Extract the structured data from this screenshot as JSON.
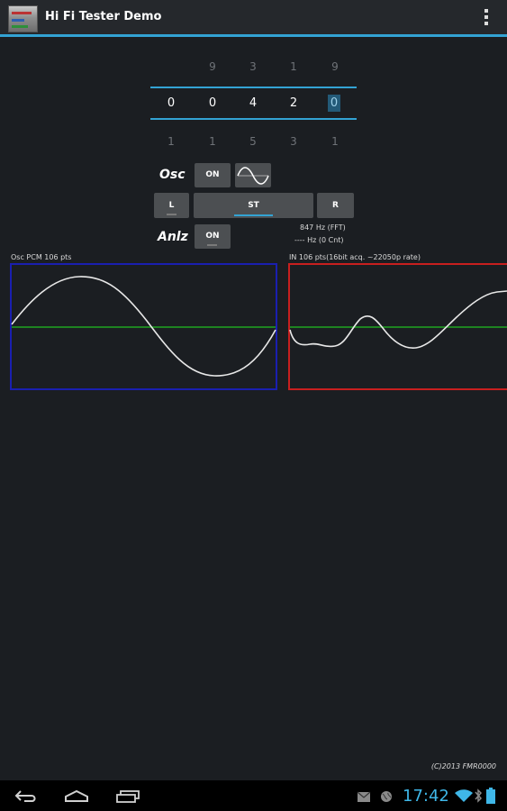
{
  "app": {
    "title": "Hi Fi Tester Demo",
    "icon": "app-icon",
    "overflow_icon": "overflow-menu-icon"
  },
  "picker": {
    "top": [
      "9",
      "3",
      "1",
      "9"
    ],
    "middle": [
      "0",
      "0",
      "4",
      "2",
      "0"
    ],
    "bottom": [
      "1",
      "1",
      "5",
      "3",
      "1"
    ]
  },
  "osc": {
    "label": "Osc",
    "on_label": "ON",
    "waveform_icon": "sine-wave-icon"
  },
  "channels": {
    "left": "L",
    "stereo": "ST",
    "right": "R"
  },
  "anlz": {
    "label": "Anlz",
    "on_label": "ON"
  },
  "readouts": {
    "fft": "847 Hz (FFT)",
    "cnt": "---- Hz (0 Cnt)"
  },
  "scopes": {
    "left_title": "Osc PCM 106 pts",
    "right_title": "IN 106 pts(16bit acq. ~22050p rate)"
  },
  "footer": {
    "copyright": "(C)2013 FMR0000"
  },
  "status": {
    "time": "17:42"
  },
  "colors": {
    "accent": "#33a3d4",
    "left_scope_border": "#1a1fb0",
    "right_scope_border": "#c81f1f",
    "zero_line": "#21c021",
    "trace": "#e8e8e8"
  }
}
